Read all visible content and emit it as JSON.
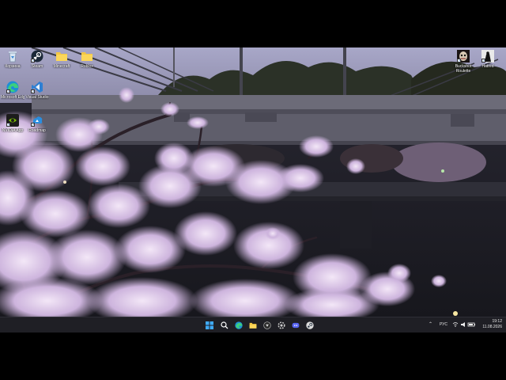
{
  "desktop": {
    "icons": [
      {
        "label": "Корзина",
        "icon": "recycle-bin-icon"
      },
      {
        "label": "Steam",
        "icon": "steam-icon"
      },
      {
        "label": "Minecraft",
        "icon": "folder-icon"
      },
      {
        "label": "Roblox",
        "icon": "folder-icon"
      },
      {
        "label": "Microsoft Edge",
        "icon": "edge-icon"
      },
      {
        "label": "Visual Studio",
        "icon": "visual-studio-icon"
      },
      {
        "label": "NVIDIA App",
        "icon": "nvidia-icon"
      },
      {
        "label": "Roadmap",
        "icon": "app-icon"
      },
      {
        "label": "Buckshot Roulette",
        "icon": "buckshot-roulette-icon"
      },
      {
        "label": "Hatred",
        "icon": "hatred-icon"
      }
    ]
  },
  "taskbar": {
    "apps": [
      "start-icon",
      "search-icon",
      "edge-icon",
      "file-explorer-icon",
      "app-icon",
      "settings-icon",
      "discord-icon",
      "steam-icon"
    ],
    "tray": {
      "language": "РУС",
      "time": "19:12",
      "date": "11.08.2026"
    }
  },
  "colors": {
    "taskbar_bg": "#1f1f25",
    "sky": "#b7b5d2",
    "blossom": "#e9d9f0"
  }
}
